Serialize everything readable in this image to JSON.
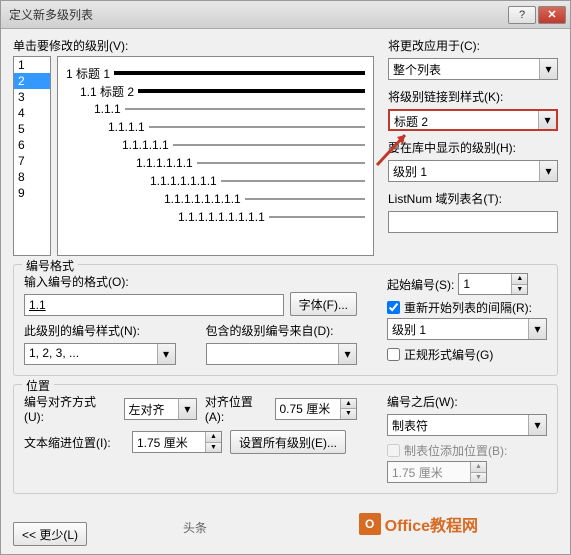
{
  "titlebar": {
    "title": "定义新多级列表"
  },
  "level_label": "单击要修改的级别(V):",
  "levels": [
    "1",
    "2",
    "3",
    "4",
    "5",
    "6",
    "7",
    "8",
    "9"
  ],
  "selected_level": "2",
  "preview": [
    {
      "indent": 0,
      "num": "1 标题 1",
      "bold": true
    },
    {
      "indent": 1,
      "num": "1.1 标题 2",
      "bold": true
    },
    {
      "indent": 2,
      "num": "1.1.1",
      "bold": false
    },
    {
      "indent": 3,
      "num": "1.1.1.1",
      "bold": false
    },
    {
      "indent": 4,
      "num": "1.1.1.1.1",
      "bold": false
    },
    {
      "indent": 5,
      "num": "1.1.1.1.1.1",
      "bold": false
    },
    {
      "indent": 6,
      "num": "1.1.1.1.1.1.1",
      "bold": false
    },
    {
      "indent": 7,
      "num": "1.1.1.1.1.1.1.1",
      "bold": false
    },
    {
      "indent": 8,
      "num": "1.1.1.1.1.1.1.1.1",
      "bold": false
    }
  ],
  "apply_changes": {
    "label": "将更改应用于(C):",
    "value": "整个列表"
  },
  "link_style": {
    "label": "将级别链接到样式(K):",
    "value": "标题 2"
  },
  "gallery_level": {
    "label": "要在库中显示的级别(H):",
    "value": "级别 1"
  },
  "listnum": {
    "label": "ListNum 域列表名(T):",
    "value": ""
  },
  "numfmt": {
    "legend": "编号格式",
    "input_label": "输入编号的格式(O):",
    "value": "1.1",
    "font_btn": "字体(F)...",
    "style_label": "此级别的编号样式(N):",
    "style_value": "1, 2, 3, ...",
    "include_label": "包含的级别编号来自(D):",
    "include_value": "",
    "start_label": "起始编号(S):",
    "start_value": "1",
    "restart_checked": true,
    "restart_label": "重新开始列表的间隔(R):",
    "restart_value": "级别 1",
    "legal_label": "正规形式编号(G)"
  },
  "position": {
    "legend": "位置",
    "align_label": "编号对齐方式(U):",
    "align_value": "左对齐",
    "align_at_label": "对齐位置(A):",
    "align_at_value": "0.75 厘米",
    "indent_label": "文本缩进位置(I):",
    "indent_value": "1.75 厘米",
    "set_all_btn": "设置所有级别(E)...",
    "follow_label": "编号之后(W):",
    "follow_value": "制表符",
    "tab_stop_label": "制表位添加位置(B):",
    "tab_stop_value": "1.75 厘米"
  },
  "less_btn": "<< 更少(L)",
  "tagline": "头条",
  "watermark": "Office教程网",
  "wm_icon_letter": "➊"
}
